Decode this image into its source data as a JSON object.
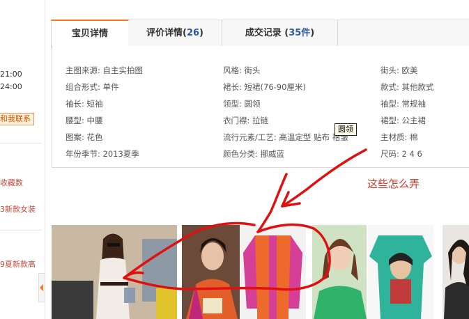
{
  "sidebar": {
    "times": [
      "21:00",
      "24:00"
    ],
    "contact_button": "和我联系",
    "links": [
      "收藏数",
      "3新款女装",
      "9夏新款高"
    ]
  },
  "tabs": [
    {
      "label": "宝贝详情",
      "count": "",
      "suffix": ""
    },
    {
      "label": "评价详情(",
      "count": "26",
      "suffix": ")"
    },
    {
      "label": "成交记录 (",
      "count": "35件",
      "suffix": ")"
    }
  ],
  "attributes": {
    "col1": [
      "主图来源: 自主实拍图",
      "组合形式: 单件",
      "袖长: 短袖",
      "腰型: 中腰",
      "图案: 花色",
      "年份季节: 2013夏季"
    ],
    "col2": [
      "风格: 街头",
      "裙长: 短裙(76-90厘米)",
      "领型: 圆领",
      "衣门襟: 拉链",
      "流行元素/工艺: 高温定型 贴布 褶皱",
      "颜色分类: 挪威蓝"
    ],
    "col3": [
      "街头: 欧美",
      "款式: 其他款式",
      "袖型: 常规袖",
      "裙型: 公主裙",
      "主材质: 棉",
      "尺码: 2 4 6"
    ]
  },
  "tooltip": "圆领",
  "annotation": "这些怎么弄",
  "thumbnails": [
    {
      "icon": "woman-white-dress-photo"
    },
    {
      "icon": "woman-orange-shirt-photo"
    },
    {
      "icon": "orange-pink-shirt-photo"
    },
    {
      "icon": "woman-green-tshirt-photo"
    },
    {
      "icon": "green-frida-tshirt-photo"
    },
    {
      "icon": "woman-dark-photo"
    }
  ],
  "colors": {
    "accent": "#f47b20",
    "count_blue": "#2b5aa4",
    "annotation_red": "#d23c2a",
    "scribble_red": "#e01010"
  }
}
